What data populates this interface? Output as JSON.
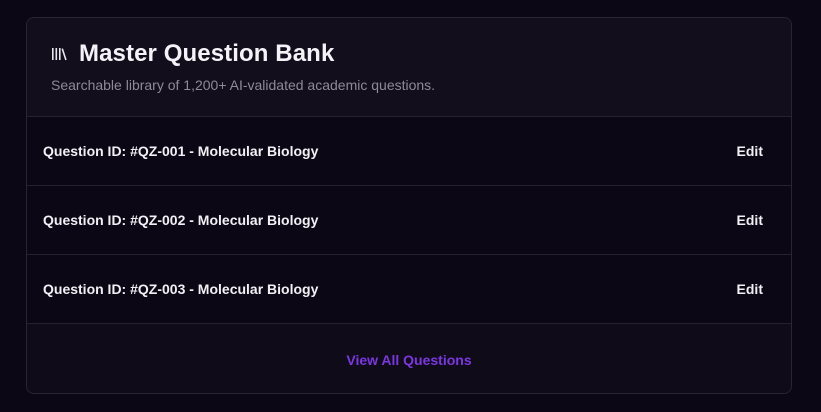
{
  "card": {
    "title": "Master Question Bank",
    "title_icon": "library-icon",
    "subtitle": "Searchable library of 1,200+ AI-validated academic questions."
  },
  "questions": [
    {
      "label": "Question ID: #QZ-001 - Molecular Biology",
      "action": "Edit"
    },
    {
      "label": "Question ID: #QZ-002 - Molecular Biology",
      "action": "Edit"
    },
    {
      "label": "Question ID: #QZ-003 - Molecular Biology",
      "action": "Edit"
    }
  ],
  "footer": {
    "view_all_label": "View All Questions"
  },
  "colors": {
    "background": "#0c0714",
    "accent": "#7a37e0",
    "text": "#f2f0f5",
    "muted": "#8d8a99"
  }
}
